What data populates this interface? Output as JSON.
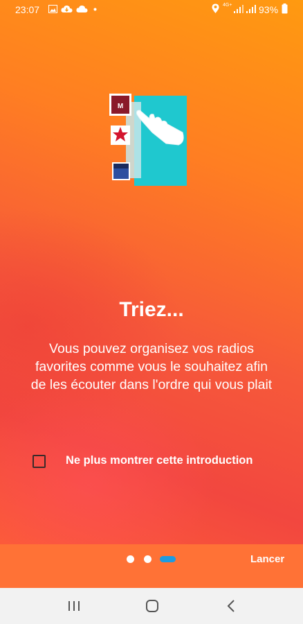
{
  "status_bar": {
    "time": "23:07",
    "battery": "93%",
    "network": "4G+",
    "icons": [
      "image-icon",
      "cloud-download-icon",
      "cloud-icon",
      "dot-icon",
      "location-icon",
      "signal-icon",
      "battery-icon"
    ]
  },
  "intro": {
    "title": "Triez...",
    "description": "Vous pouvez organisez vos radios favorites comme vous le souhaitez afin de les écouter dans l'ordre qui vous plait",
    "checkbox_label": "Ne plus montrer cette introduction",
    "checkbox_checked": false
  },
  "pager": {
    "page_count": 3,
    "current_page": 3,
    "launch_label": "Lancer"
  },
  "nav_bar": {
    "buttons": [
      "recent-apps-icon",
      "home-icon",
      "back-icon"
    ]
  },
  "colors": {
    "accent_blue": "#1e9be0",
    "orange": "#ff7236",
    "teal": "#1fc8cf"
  }
}
